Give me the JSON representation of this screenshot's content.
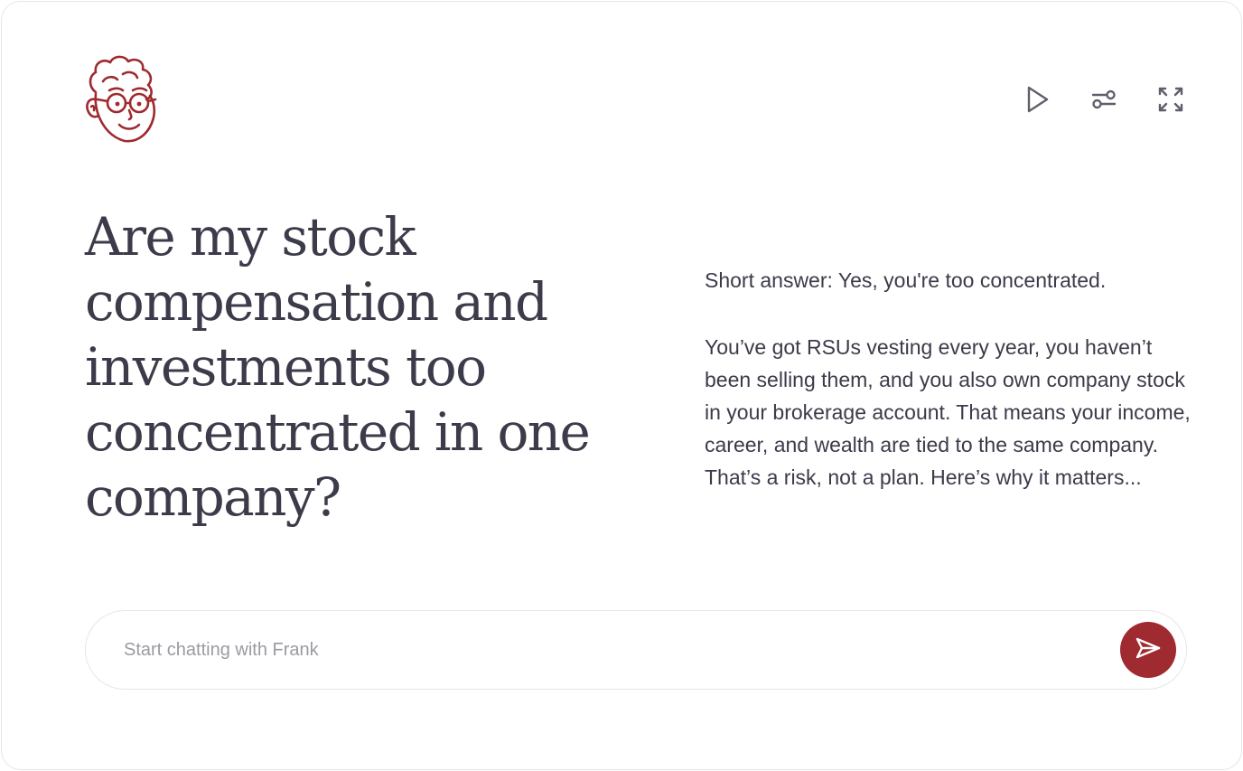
{
  "app": {
    "assistant_name": "Frank",
    "accent_color": "#9f2a2f",
    "icon_color": "#5f5f6c"
  },
  "header": {
    "avatar_icon": "frank-avatar-icon",
    "controls": [
      {
        "icon": "play-icon"
      },
      {
        "icon": "sliders-icon"
      },
      {
        "icon": "expand-icon"
      }
    ]
  },
  "main": {
    "question": "Are my stock compensation and investments too concentrated in one company?",
    "answer_short": "Short answer: Yes, you're too concentrated.",
    "answer_body": "You’ve got RSUs vesting every year, you haven’t been selling them, and you also own company stock in your brokerage account. That means your income, career, and wealth are tied to the same company. That’s a risk, not a plan. Here’s why it matters..."
  },
  "chat": {
    "placeholder": "Start chatting with Frank",
    "value": "",
    "send_icon": "send-icon"
  }
}
